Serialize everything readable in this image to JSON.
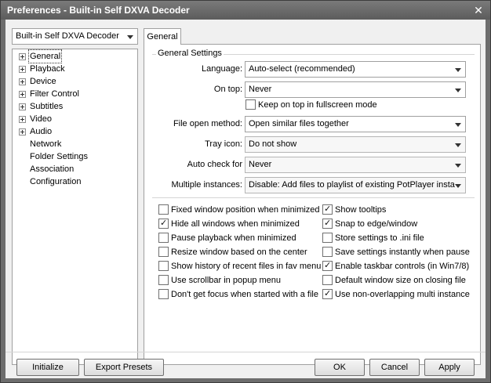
{
  "window": {
    "title": "Preferences - Built-in Self DXVA Decoder",
    "close_symbol": "✕"
  },
  "profile_combo": {
    "value": "Built-in Self DXVA Decoder"
  },
  "tree": {
    "items": [
      {
        "label": "General",
        "expandable": true,
        "selected": true
      },
      {
        "label": "Playback",
        "expandable": true
      },
      {
        "label": "Device",
        "expandable": true
      },
      {
        "label": "Filter Control",
        "expandable": true
      },
      {
        "label": "Subtitles",
        "expandable": true
      },
      {
        "label": "Video",
        "expandable": true
      },
      {
        "label": "Audio",
        "expandable": true
      },
      {
        "label": "Network",
        "expandable": false
      },
      {
        "label": "Folder Settings",
        "expandable": false
      },
      {
        "label": "Association",
        "expandable": false
      },
      {
        "label": "Configuration",
        "expandable": false
      }
    ]
  },
  "tab": {
    "label": "General"
  },
  "general_settings": {
    "group_title": "General Settings",
    "language": {
      "label": "Language:",
      "value": "Auto-select (recommended)"
    },
    "on_top": {
      "label": "On top:",
      "value": "Never"
    },
    "keep_on_top": {
      "label": "Keep on top in fullscreen mode",
      "checked": false
    },
    "file_open_method": {
      "label": "File open method:",
      "value": "Open similar files together"
    },
    "tray_icon": {
      "label": "Tray icon:",
      "value": "Do not show"
    },
    "auto_check": {
      "label": "Auto check for",
      "value": "Never"
    },
    "multiple_instances": {
      "label": "Multiple instances:",
      "value": "Disable: Add files to playlist of existing PotPlayer insta"
    }
  },
  "options_left": [
    {
      "label": "Fixed window position when minimized",
      "checked": false
    },
    {
      "label": "Hide all windows when minimized",
      "checked": true
    },
    {
      "label": "Pause playback when minimized",
      "checked": false
    },
    {
      "label": "Resize window based on the center",
      "checked": false
    },
    {
      "label": "Show history of recent files in fav menu",
      "checked": false
    },
    {
      "label": "Use scrollbar in popup menu",
      "checked": false
    },
    {
      "label": "Don't get focus when started with a file",
      "checked": false
    }
  ],
  "options_right": [
    {
      "label": "Show tooltips",
      "checked": true
    },
    {
      "label": "Snap to edge/window",
      "checked": true
    },
    {
      "label": "Store settings to .ini file",
      "checked": false
    },
    {
      "label": "Save settings instantly when pause",
      "checked": false
    },
    {
      "label": "Enable taskbar controls (in Win7/8)",
      "checked": true
    },
    {
      "label": "Default window size on closing file",
      "checked": false
    },
    {
      "label": "Use non-overlapping multi instance",
      "checked": true
    }
  ],
  "buttons": {
    "initialize": "Initialize",
    "export_presets": "Export Presets",
    "ok": "OK",
    "cancel": "Cancel",
    "apply": "Apply"
  }
}
